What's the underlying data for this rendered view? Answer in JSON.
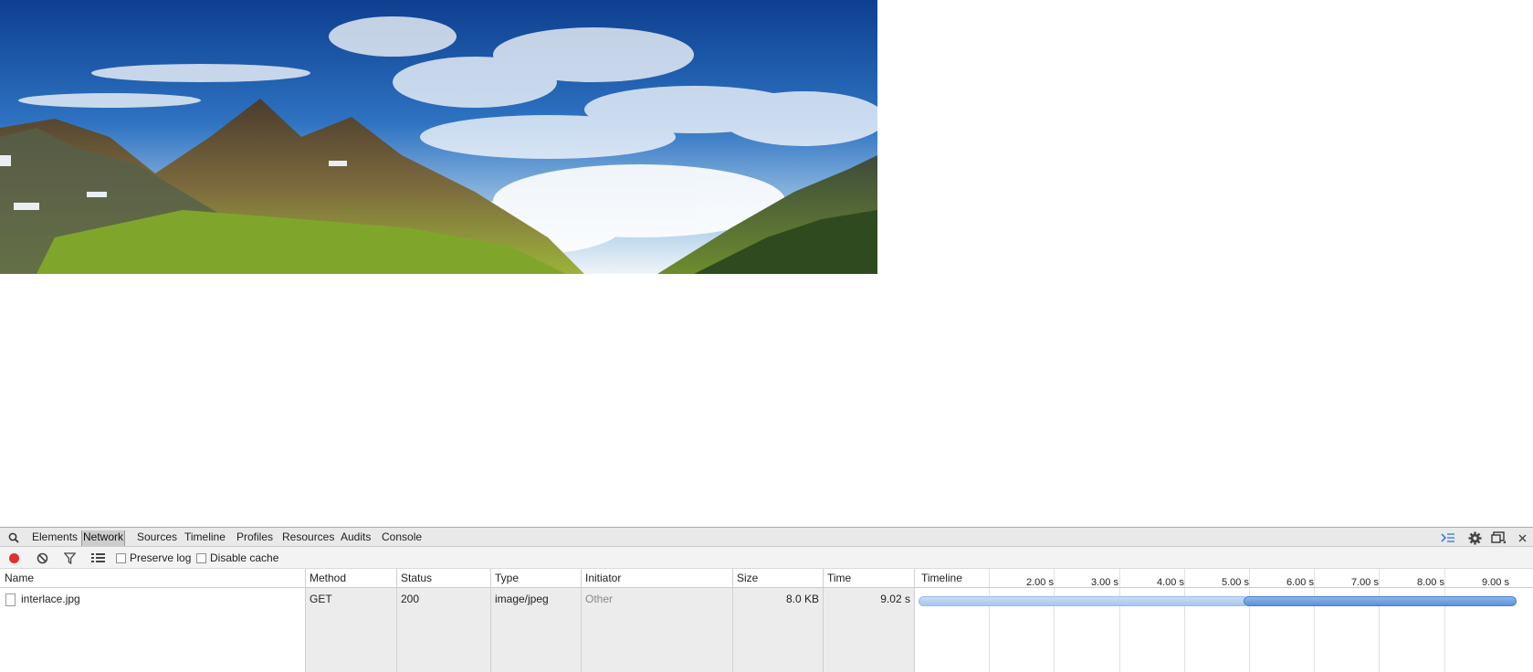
{
  "page": {
    "image_alt": "mountain landscape with blue sky and clouds"
  },
  "devtools": {
    "tabs": [
      "Elements",
      "Network",
      "Sources",
      "Timeline",
      "Profiles",
      "Resources",
      "Audits",
      "Console"
    ],
    "active_tab": "Network",
    "toolbar": {
      "preserve_log_label": "Preserve log",
      "preserve_log_checked": false,
      "disable_cache_label": "Disable cache",
      "disable_cache_checked": false
    },
    "columns": {
      "name": "Name",
      "method": "Method",
      "status": "Status",
      "type": "Type",
      "initiator": "Initiator",
      "size": "Size",
      "time": "Time",
      "timeline": "Timeline"
    },
    "timeline_ticks": [
      "2.00 s",
      "3.00 s",
      "4.00 s",
      "5.00 s",
      "6.00 s",
      "7.00 s",
      "8.00 s",
      "9.00 s"
    ],
    "requests": [
      {
        "name": "interlace.jpg",
        "method": "GET",
        "status": "200",
        "type": "image/jpeg",
        "initiator": "Other",
        "size": "8.0 KB",
        "time": "9.02 s"
      }
    ],
    "colors": {
      "record": "#e0312c",
      "accent": "#5e93db",
      "waiting": "#b8d1f1"
    }
  }
}
